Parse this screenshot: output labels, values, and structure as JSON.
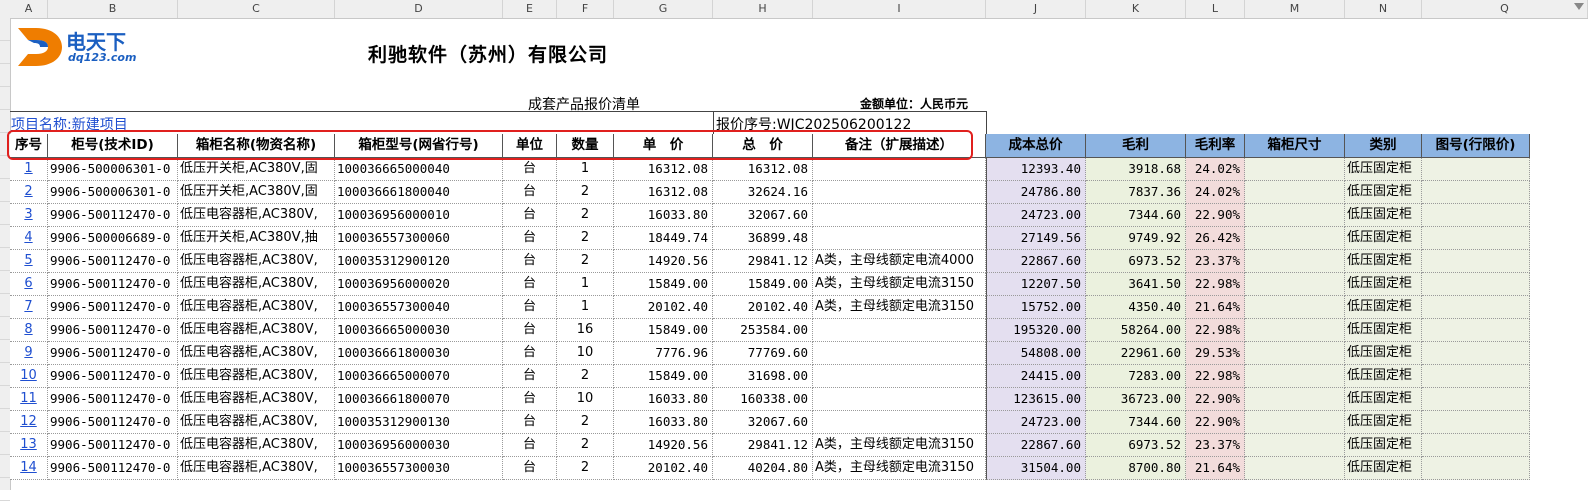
{
  "column_letters": [
    "A",
    "B",
    "C",
    "D",
    "E",
    "F",
    "G",
    "H",
    "I",
    "J",
    "K",
    "L",
    "M",
    "N",
    "Q"
  ],
  "logo": {
    "text": "电天下",
    "url_text": "dq123.com"
  },
  "company_title": "利驰软件（苏州）有限公司",
  "subtitle": "成套产品报价清单",
  "currency_label": "金额单位：人民币元",
  "project_label": "项目名称:新建项目",
  "quote_label": "报价序号:WJC202506200122",
  "headers": [
    "序号",
    "柜号(技术ID)",
    "箱柜名称(物资名称)",
    "箱柜型号(网省行号)",
    "单位",
    "数量",
    "单　价",
    "总　价",
    "备注（扩展描述）",
    "成本总价",
    "毛利",
    "毛利率",
    "箱柜尺寸",
    "类别",
    "图号(行限价)"
  ],
  "rows": [
    [
      "1",
      "9906-500006301-0",
      "低压开关柜,AC380V,固",
      "100036665000040",
      "台",
      "1",
      "16312.08",
      "16312.08",
      "",
      "12393.40",
      "3918.68",
      "24.02%",
      "",
      "低压固定柜",
      ""
    ],
    [
      "2",
      "9906-500006301-0",
      "低压开关柜,AC380V,固",
      "100036661800040",
      "台",
      "2",
      "16312.08",
      "32624.16",
      "",
      "24786.80",
      "7837.36",
      "24.02%",
      "",
      "低压固定柜",
      ""
    ],
    [
      "3",
      "9906-500112470-0",
      "低压电容器柜,AC380V,",
      "100036956000010",
      "台",
      "2",
      "16033.80",
      "32067.60",
      "",
      "24723.00",
      "7344.60",
      "22.90%",
      "",
      "低压固定柜",
      ""
    ],
    [
      "4",
      "9906-500006689-0",
      "低压开关柜,AC380V,抽",
      "100036557300060",
      "台",
      "2",
      "18449.74",
      "36899.48",
      "",
      "27149.56",
      "9749.92",
      "26.42%",
      "",
      "低压固定柜",
      ""
    ],
    [
      "5",
      "9906-500112470-0",
      "低压电容器柜,AC380V,",
      "100035312900120",
      "台",
      "2",
      "14920.56",
      "29841.12",
      "A类，主母线额定电流4000",
      "22867.60",
      "6973.52",
      "23.37%",
      "",
      "低压固定柜",
      ""
    ],
    [
      "6",
      "9906-500112470-0",
      "低压电容器柜,AC380V,",
      "100036956000020",
      "台",
      "1",
      "15849.00",
      "15849.00",
      "A类，主母线额定电流3150",
      "12207.50",
      "3641.50",
      "22.98%",
      "",
      "低压固定柜",
      ""
    ],
    [
      "7",
      "9906-500112470-0",
      "低压电容器柜,AC380V,",
      "100036557300040",
      "台",
      "1",
      "20102.40",
      "20102.40",
      "A类，主母线额定电流3150",
      "15752.00",
      "4350.40",
      "21.64%",
      "",
      "低压固定柜",
      ""
    ],
    [
      "8",
      "9906-500112470-0",
      "低压电容器柜,AC380V,",
      "100036665000030",
      "台",
      "16",
      "15849.00",
      "253584.00",
      "",
      "195320.00",
      "58264.00",
      "22.98%",
      "",
      "低压固定柜",
      ""
    ],
    [
      "9",
      "9906-500112470-0",
      "低压电容器柜,AC380V,",
      "100036661800030",
      "台",
      "10",
      "7776.96",
      "77769.60",
      "",
      "54808.00",
      "22961.60",
      "29.53%",
      "",
      "低压固定柜",
      ""
    ],
    [
      "10",
      "9906-500112470-0",
      "低压电容器柜,AC380V,",
      "100036665000070",
      "台",
      "2",
      "15849.00",
      "31698.00",
      "",
      "24415.00",
      "7283.00",
      "22.98%",
      "",
      "低压固定柜",
      ""
    ],
    [
      "11",
      "9906-500112470-0",
      "低压电容器柜,AC380V,",
      "100036661800070",
      "台",
      "10",
      "16033.80",
      "160338.00",
      "",
      "123615.00",
      "36723.00",
      "22.90%",
      "",
      "低压固定柜",
      ""
    ],
    [
      "12",
      "9906-500112470-0",
      "低压电容器柜,AC380V,",
      "100035312900130",
      "台",
      "2",
      "16033.80",
      "32067.60",
      "",
      "24723.00",
      "7344.60",
      "22.90%",
      "",
      "低压固定柜",
      ""
    ],
    [
      "13",
      "9906-500112470-0",
      "低压电容器柜,AC380V,",
      "100036956000030",
      "台",
      "2",
      "14920.56",
      "29841.12",
      "A类，主母线额定电流3150",
      "22867.60",
      "6973.52",
      "23.37%",
      "",
      "低压固定柜",
      ""
    ],
    [
      "14",
      "9906-500112470-0",
      "低压电容器柜,AC380V,",
      "100036557300030",
      "台",
      "2",
      "20102.40",
      "40204.80",
      "A类，主母线额定电流3150",
      "31504.00",
      "8700.80",
      "21.64%",
      "",
      "低压固定柜",
      ""
    ]
  ],
  "colors": {
    "header_blue": "#8db4e2",
    "cost_fill": "#e4dff0",
    "profit_fill": "#ebf1de",
    "rate_fill": "#f2dcdb",
    "grey_fill": "#eef2e4",
    "highlight_border": "#e0201e",
    "link": "#1f4fd0"
  }
}
